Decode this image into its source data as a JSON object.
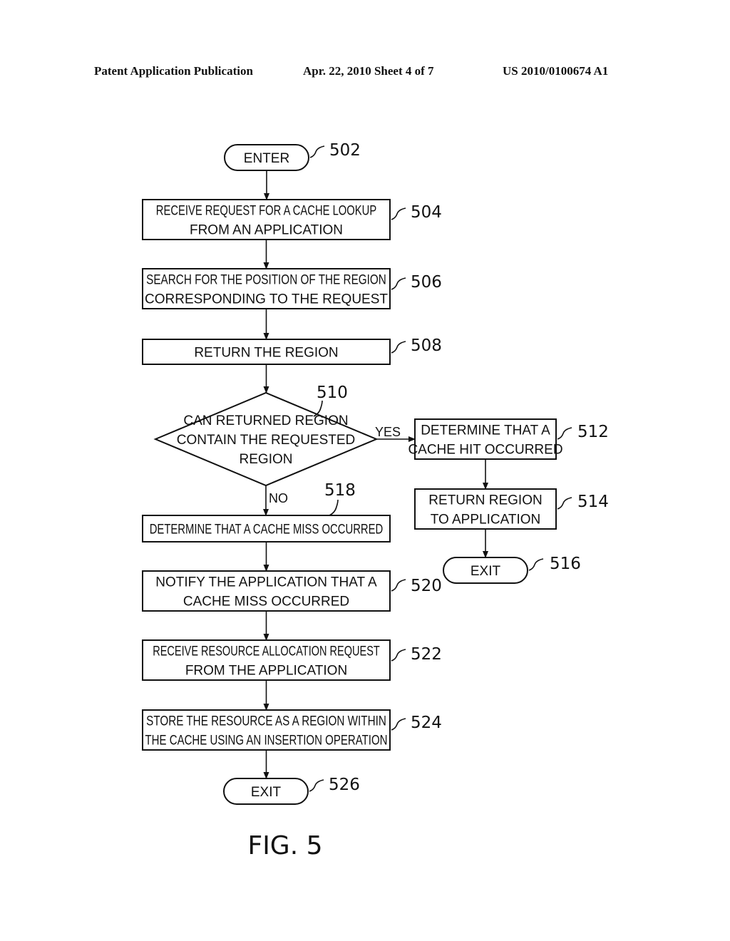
{
  "header": {
    "left": "Patent Application Publication",
    "middle": "Apr. 22, 2010  Sheet 4 of 7",
    "right": "US 2010/0100674 A1"
  },
  "figure_label": "FIG. 5",
  "nodes": {
    "n502": {
      "type": "terminal",
      "ref": "502",
      "lines": [
        "ENTER"
      ]
    },
    "n504": {
      "type": "process",
      "ref": "504",
      "lines": [
        "RECEIVE REQUEST FOR A CACHE LOOKUP",
        "FROM AN APPLICATION"
      ]
    },
    "n506": {
      "type": "process",
      "ref": "506",
      "lines": [
        "SEARCH FOR THE POSITION OF THE REGION",
        "CORRESPONDING TO THE REQUEST"
      ]
    },
    "n508": {
      "type": "process",
      "ref": "508",
      "lines": [
        "RETURN THE REGION"
      ]
    },
    "n510": {
      "type": "decision",
      "ref": "510",
      "lines": [
        "CAN RETURNED REGION",
        "CONTAIN THE REQUESTED",
        "REGION"
      ]
    },
    "n512": {
      "type": "process",
      "ref": "512",
      "lines": [
        "DETERMINE THAT A",
        "CACHE HIT OCCURRED"
      ]
    },
    "n514": {
      "type": "process",
      "ref": "514",
      "lines": [
        "RETURN REGION",
        "TO APPLICATION"
      ]
    },
    "n516": {
      "type": "terminal",
      "ref": "516",
      "lines": [
        "EXIT"
      ]
    },
    "n518": {
      "type": "process",
      "ref": "518",
      "lines": [
        "DETERMINE THAT A CACHE MISS OCCURRED"
      ]
    },
    "n520": {
      "type": "process",
      "ref": "520",
      "lines": [
        "NOTIFY THE APPLICATION THAT A",
        "CACHE MISS OCCURRED"
      ]
    },
    "n522": {
      "type": "process",
      "ref": "522",
      "lines": [
        "RECEIVE RESOURCE ALLOCATION REQUEST",
        "FROM THE APPLICATION"
      ]
    },
    "n524": {
      "type": "process",
      "ref": "524",
      "lines": [
        "STORE THE RESOURCE AS A REGION WITHIN",
        "THE CACHE USING AN INSERTION OPERATION"
      ]
    },
    "n526": {
      "type": "terminal",
      "ref": "526",
      "lines": [
        "EXIT"
      ]
    }
  },
  "edges": [
    {
      "from": "502",
      "to": "504",
      "label": ""
    },
    {
      "from": "504",
      "to": "506",
      "label": ""
    },
    {
      "from": "506",
      "to": "508",
      "label": ""
    },
    {
      "from": "508",
      "to": "510",
      "label": ""
    },
    {
      "from": "510",
      "to": "512",
      "label": "YES"
    },
    {
      "from": "512",
      "to": "514",
      "label": ""
    },
    {
      "from": "514",
      "to": "516",
      "label": ""
    },
    {
      "from": "510",
      "to": "518",
      "label": "NO"
    },
    {
      "from": "518",
      "to": "520",
      "label": ""
    },
    {
      "from": "520",
      "to": "522",
      "label": ""
    },
    {
      "from": "522",
      "to": "524",
      "label": ""
    },
    {
      "from": "524",
      "to": "526",
      "label": ""
    }
  ]
}
